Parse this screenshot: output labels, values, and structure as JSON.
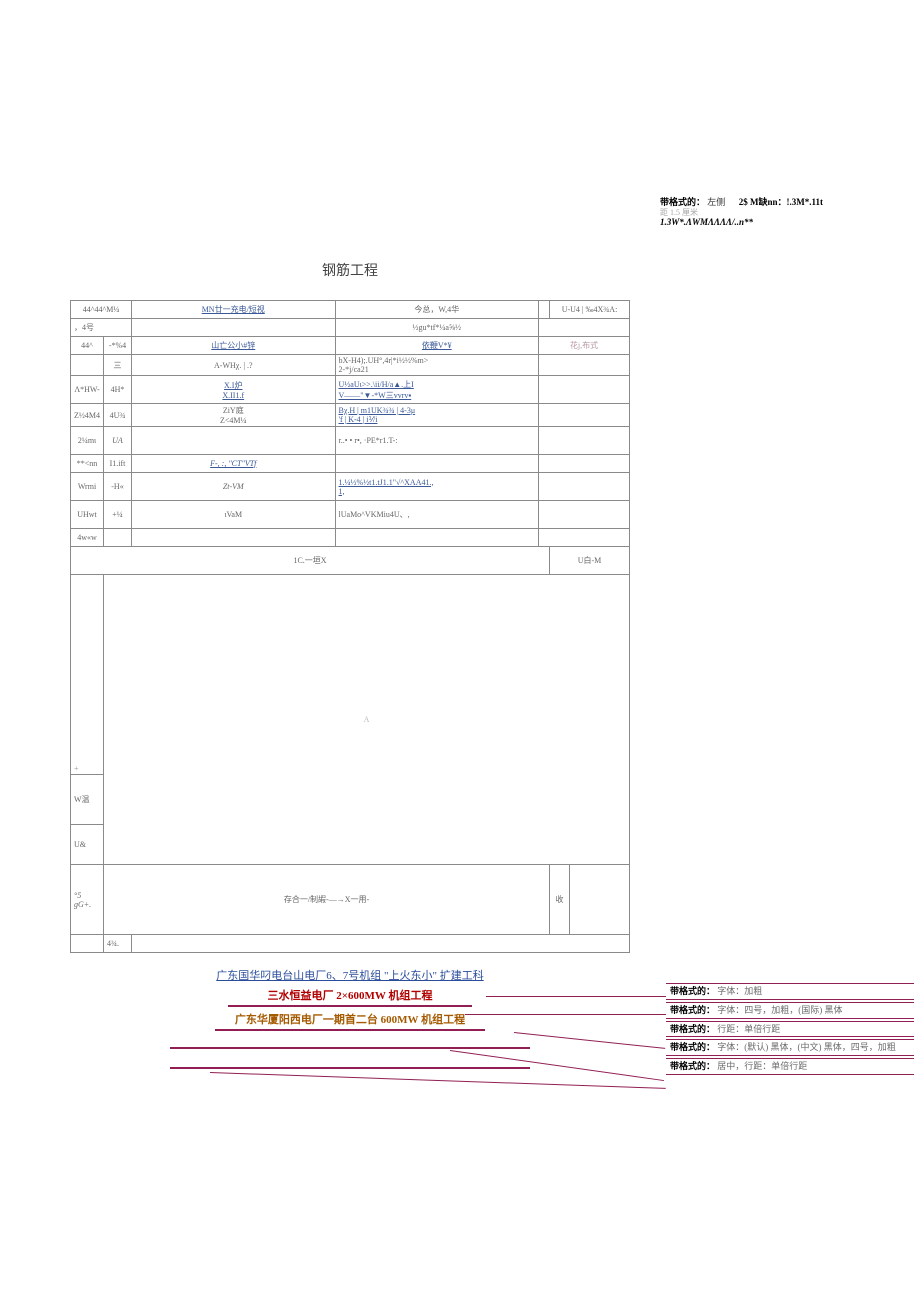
{
  "noteTR": {
    "label1": "带格式的：",
    "val1a": "左侧",
    "val1b": "2$ M缺nn：!.3M*.11t",
    "line2": "距   1.5 厘米",
    "line3": "1.3W*.ΛWMΛΛΛΛ/..n**"
  },
  "title": "钢筋工程",
  "headerRow": {
    "c1": "44^44^M¼",
    "c2": "MN廿一充电/短视",
    "c3": "今总，W,4华",
    "c4": "",
    "c5": "U-U4  | ‰4X¾A:"
  },
  "row4hao": {
    "label": "，4号",
    "sub": "½gu*tf*¼a⅝½"
  },
  "rows": [
    {
      "a": "44^",
      "b": "-*%4",
      "c": "山亡公小#锌",
      "d": "依鞭V*¥",
      "e": "花j,布式"
    },
    {
      "a": "",
      "b": "三",
      "c": "A-WHχ. | .?",
      "d": "bX-H4);.UH°,4r|*i½½%m>\n2-*j/ca21",
      "e": ""
    },
    {
      "a": "Λ*HW-",
      "b": "4H*",
      "c": "X.I炉\nX.II1.f",
      "d": "U½aUι>>.\\ii/H/a▲.上I\nV——\"▼-*W三vvrv▪",
      "e": ""
    },
    {
      "a": "Z½4M4",
      "b": "4U¾",
      "c": "ZiY庭\nZ<4M¼",
      "d": "Bχ.H | m1UK¾¾ | 4-3μ\n'f | K-4 | i⅟/i",
      "e": ""
    },
    {
      "a": "2¼mι",
      "b": "UA",
      "c": "",
      "d": "r..• • r•, ·PE*r1.T-:",
      "e": ""
    },
    {
      "a": "**<nn",
      "b": "I1.ift",
      "c": "F-, :, \"CT\"VTf",
      "d": "",
      "e": ""
    },
    {
      "a": "Wrmi",
      "b": "-H«",
      "c": "Zt-VM",
      "d": "1.¼½%½t1.tJ1.1\"√^XAA41.,\n1,",
      "e": ""
    },
    {
      "a": "UHwt",
      "b": "+¼",
      "c": "ιVaM",
      "d": "lUaMo^VKMiu4U、,",
      "e": ""
    },
    {
      "a": "4w«w",
      "b": "",
      "c": "",
      "d": "",
      "e": ""
    }
  ],
  "midLine": "1C.一垣X",
  "midRight": "U白-M",
  "bigLeft1": "+",
  "bigMid": "A",
  "bigLeft2": "W温",
  "bigLeft3": "U&",
  "secLeft": "°5\ngG+.",
  "secMid": "存合一/制嘏-—→X一用-",
  "secRight": "收",
  "secFoot": "4¾.",
  "projects": {
    "p1": "广东国华叼电台山电厂6、7号机组 \"上火东小\" 扩建工科",
    "p2": "三水恒益电厂 2×600MW 机组工程",
    "p3": "广东华厦阳西电厂一期首二台 600MW  机组工程"
  },
  "callouts": [
    {
      "lbl": "带格式的：",
      "val": "字体：加粗"
    },
    {
      "lbl": "带格式的：",
      "val": "字体：四号，加粗，(国际) 黑体"
    },
    {
      "lbl": "带格式的：",
      "val": "行距：单倍行距"
    },
    {
      "lbl": "带格式的：",
      "val": "字体：(默认) 黑体，(中文) 黑体，四号，加粗"
    },
    {
      "lbl": "带格式的：",
      "val": "居中，行距：单倍行距"
    }
  ]
}
